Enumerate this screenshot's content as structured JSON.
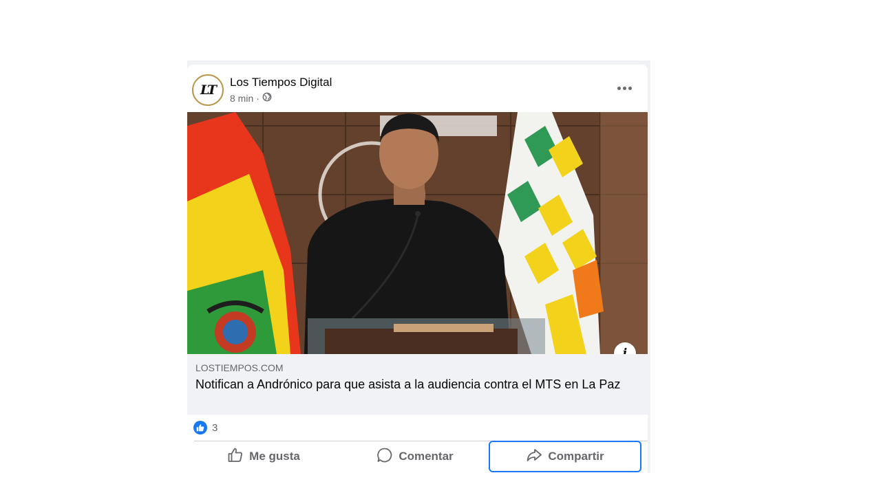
{
  "post": {
    "page_name": "Los Tiempos Digital",
    "avatar_text": "LT",
    "time": "8 min",
    "separator": "·",
    "privacy_icon": "globe-icon",
    "more_icon": "more-icon"
  },
  "link": {
    "domain": "LOSTIEMPOS.COM",
    "headline": "Notifican a Andrónico para que asista a la audiencia contra el MTS en La Paz",
    "info_glyph": "i"
  },
  "reactions": {
    "type_icon": "like-icon",
    "count": "3"
  },
  "actions": {
    "like": "Me gusta",
    "comment": "Comentar",
    "share": "Compartir"
  },
  "colors": {
    "accent": "#1877f2",
    "text_primary": "#050505",
    "text_secondary": "#65676b",
    "link_bg": "#f0f2f5"
  }
}
